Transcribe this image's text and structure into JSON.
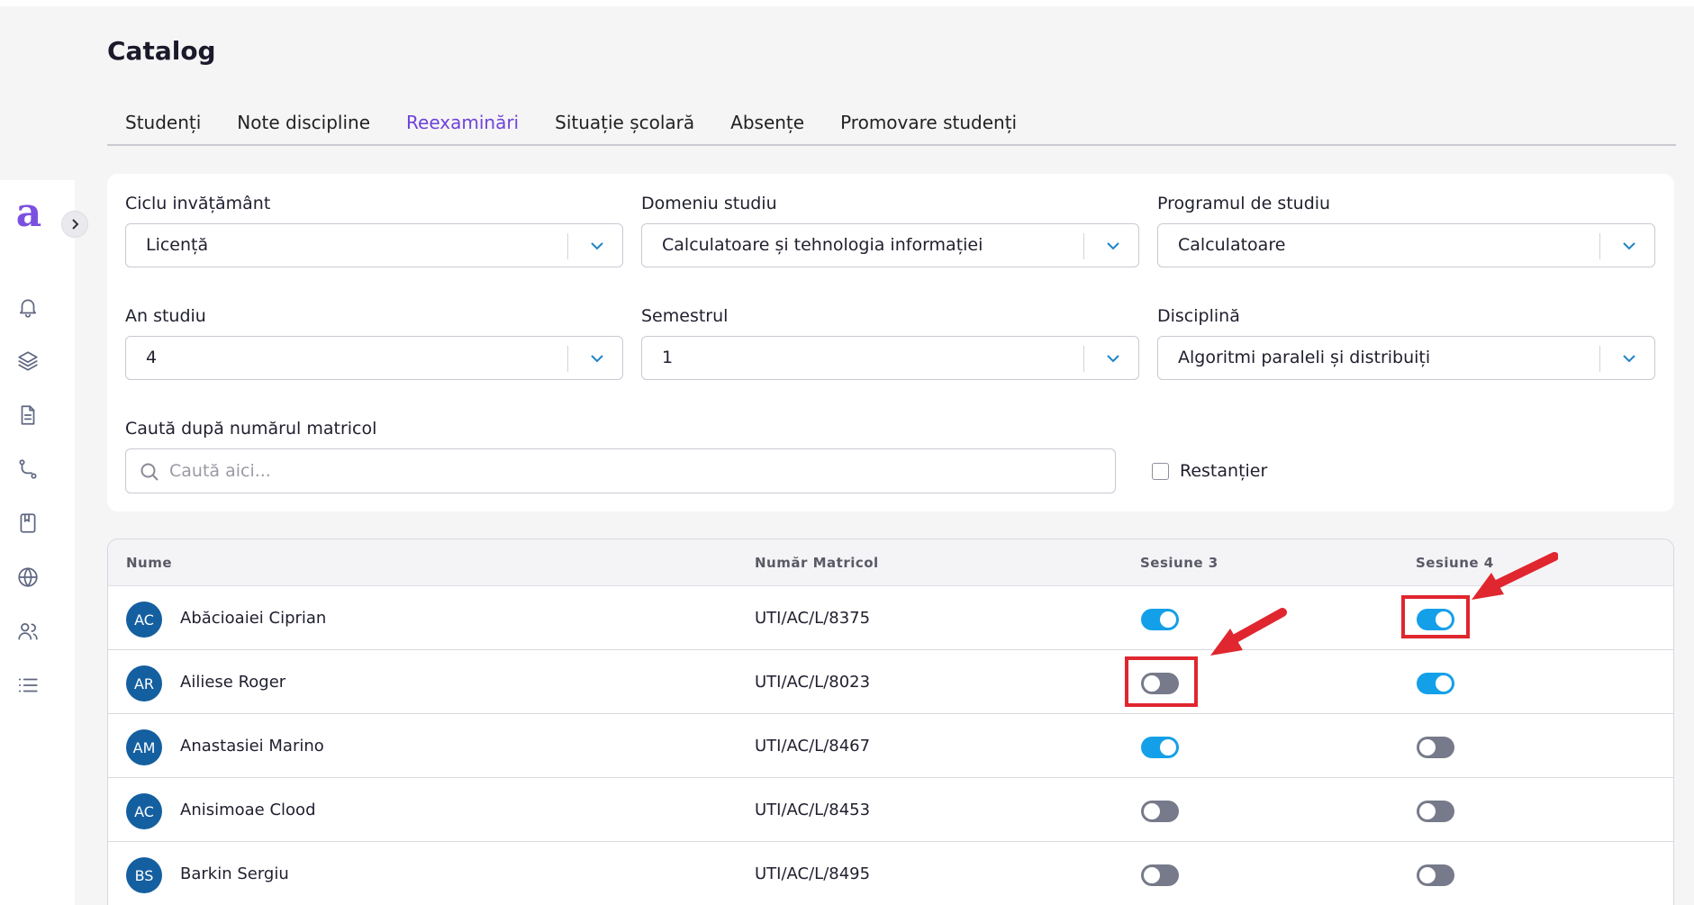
{
  "page": {
    "title": "Catalog"
  },
  "brand": {
    "logo_letter": "a",
    "accent_color": "#6f42d8",
    "toggle_on_color": "#14a0e8",
    "avatar_color": "#145fa0",
    "highlight_color": "#e0262e"
  },
  "sidebar": {
    "icons": [
      "bell-icon",
      "layers-icon",
      "document-icon",
      "route-icon",
      "book-icon",
      "globe-icon",
      "users-icon",
      "list-icon"
    ]
  },
  "tabs": [
    {
      "label": "Studenți",
      "active": false
    },
    {
      "label": "Note discipline",
      "active": false
    },
    {
      "label": "Reexaminări",
      "active": true
    },
    {
      "label": "Situație școlară",
      "active": false
    },
    {
      "label": "Absențe",
      "active": false
    },
    {
      "label": "Promovare studenți",
      "active": false
    }
  ],
  "filters": {
    "ciclu": {
      "label": "Ciclu invățământ",
      "value": "Licență"
    },
    "domeniu": {
      "label": "Domeniu studiu",
      "value": "Calculatoare și tehnologia informației"
    },
    "program": {
      "label": "Programul de studiu",
      "value": "Calculatoare"
    },
    "an": {
      "label": "An studiu",
      "value": "4"
    },
    "semestru": {
      "label": "Semestrul",
      "value": "1"
    },
    "disciplina": {
      "label": "Disciplină",
      "value": "Algoritmi paraleli și distribuiți"
    },
    "search": {
      "label": "Caută după numărul matricol",
      "placeholder": "Caută aici..."
    },
    "restantier": {
      "label": "Restanțier",
      "checked": false
    }
  },
  "table": {
    "headers": {
      "nume": "Nume",
      "matricol": "Număr Matricol",
      "s3": "Sesiune 3",
      "s4": "Sesiune 4"
    },
    "rows": [
      {
        "initials": "AC",
        "name": "Abăcioaiei Ciprian",
        "matricol": "UTI/AC/L/8375",
        "s3": true,
        "s4": true
      },
      {
        "initials": "AR",
        "name": "Ailiese Roger",
        "matricol": "UTI/AC/L/8023",
        "s3": false,
        "s4": true
      },
      {
        "initials": "AM",
        "name": "Anastasiei Marino",
        "matricol": "UTI/AC/L/8467",
        "s3": true,
        "s4": false
      },
      {
        "initials": "AC",
        "name": "Anisimoae Clood",
        "matricol": "UTI/AC/L/8453",
        "s3": false,
        "s4": false
      },
      {
        "initials": "BS",
        "name": "Barkin Sergiu",
        "matricol": "UTI/AC/L/8495",
        "s3": false,
        "s4": false
      }
    ]
  }
}
